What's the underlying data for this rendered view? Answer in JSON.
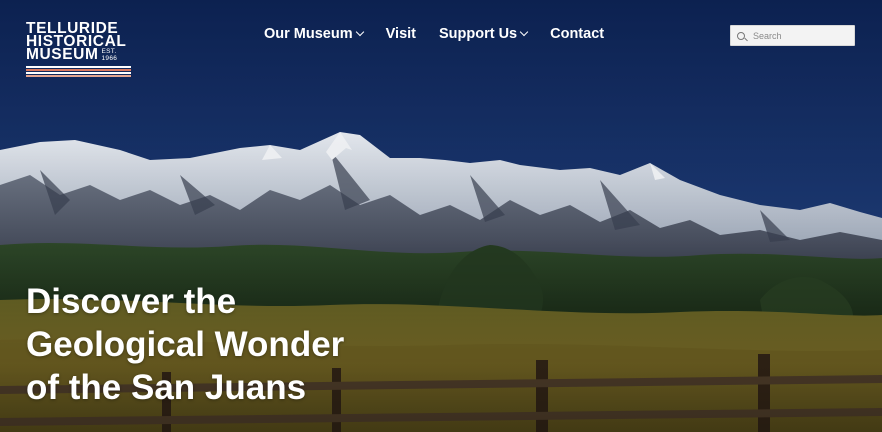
{
  "logo": {
    "line1": "TELLURIDE",
    "line2": "HISTORICAL",
    "line3": "MUSEUM",
    "est_top": "EST.",
    "est_year": "1966",
    "stripe_colors": [
      "#ffffff",
      "#d9785f",
      "#ffffff",
      "#e3a58f",
      "#ffffff"
    ]
  },
  "nav": {
    "items": [
      {
        "label": "Our Museum",
        "has_dropdown": true
      },
      {
        "label": "Visit",
        "has_dropdown": false
      },
      {
        "label": "Support Us",
        "has_dropdown": true
      },
      {
        "label": "Contact",
        "has_dropdown": false
      }
    ]
  },
  "search": {
    "placeholder": "Search",
    "value": ""
  },
  "hero": {
    "headline_lines": [
      "Discover the",
      "Geological Wonder",
      "of the San Juans"
    ]
  },
  "colors": {
    "sky_top": "#0d2352",
    "sky_bottom": "#2b4a86",
    "text": "#ffffff"
  }
}
